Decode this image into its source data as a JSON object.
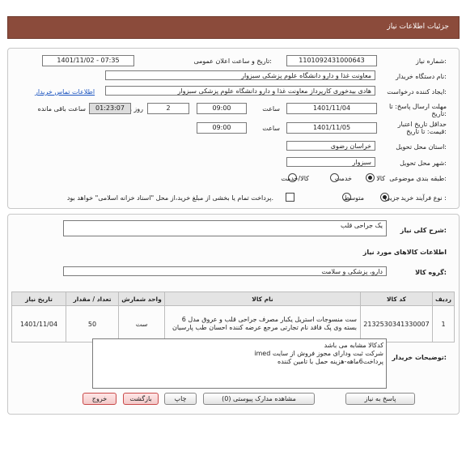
{
  "header": {
    "title": "جزئیات اطلاعات نیاز"
  },
  "form": {
    "need_number_label": "شماره نیاز:",
    "need_number": "1101092431000643",
    "announce_label": "تاریخ و ساعت اعلان عمومی:",
    "announce_value": "1401/11/02 - 07:35",
    "buyer_org_label": "نام دستگاه خریدار:",
    "buyer_org": "معاونت غذا و دارو   دانشگاه علوم پزشکی سبزوار",
    "creator_label": "ایجاد کننده درخواست:",
    "creator": "هادی بیدخوری کارپرداز معاونت غذا و دارو   دانشگاه علوم پزشکی سبزوار",
    "contact_link": "اطلاعات تماس خریدار",
    "deadline_label_1": "مهلت ارسال پاسخ: تا",
    "deadline_label_2": "تاریخ:",
    "deadline_date": "1401/11/04",
    "time_label": "ساعت",
    "deadline_time": "09:00",
    "days_value": "2",
    "days_label": "روز و",
    "remaining_time": "01:23:07",
    "remaining_label": "ساعت باقی مانده",
    "validity_label_1": "حداقل تاریخ اعتبار",
    "validity_label_2": "قیمت: تا تاریخ:",
    "validity_date": "1401/11/05",
    "validity_time_label": "ساعت",
    "validity_time": "09:00",
    "province_label": "استان محل تحویل:",
    "province": "خراسان رضوی",
    "city_label": "شهر محل تحویل:",
    "city": "سبزوار",
    "category_label": "طبقه بندی موضوعی:",
    "category_options": [
      "کالا",
      "خدمت",
      "کالا/خدمت"
    ],
    "purchase_label": "نوع فرآیند خرید :",
    "purchase_options": [
      "جزیی",
      "متوسط"
    ],
    "payment_note": "پرداخت تمام یا بخشی از مبلغ خرید،از محل \"اسناد خزانه اسلامی\" خواهد بود."
  },
  "summary": {
    "label": "شرح کلی نیاز:",
    "value": "یک جراحی قلب"
  },
  "goods": {
    "section_title": "اطلاعات کالاهای مورد نیاز",
    "group_label": "گروه کالا:",
    "group_value": "دارو، پزشکی و سلامت",
    "columns": [
      "ردیف",
      "کد کالا",
      "نام کالا",
      "واحد شمارش",
      "تعداد / مقدار",
      "تاریخ نیاز"
    ],
    "rows": [
      {
        "index": "1",
        "code": "2132530341330007",
        "name": "ست منسوجات استریل یکبار مصرف جراحی قلب و عروق مدل 6 بسته وی پک فاقد نام تجارتی مرجع عرضه کننده احسان طب پارسیان",
        "unit": "ست",
        "qty": "50",
        "date": "1401/11/04"
      }
    ]
  },
  "buyer_notes": {
    "label": "توضیحات خریدار:",
    "lines": [
      "کدکالا مشابه می باشد",
      "شرکت ثبت ودارای مجوز فروش از سایت imed",
      "پرداخت6ماهه-هزینه حمل با تامین کننده"
    ]
  },
  "buttons": {
    "reply": "پاسخ به نیاز",
    "view_docs": "مشاهده مدارک پیوستی (0)",
    "print": "چاپ",
    "back": "بازگشت",
    "exit": "خروج"
  }
}
